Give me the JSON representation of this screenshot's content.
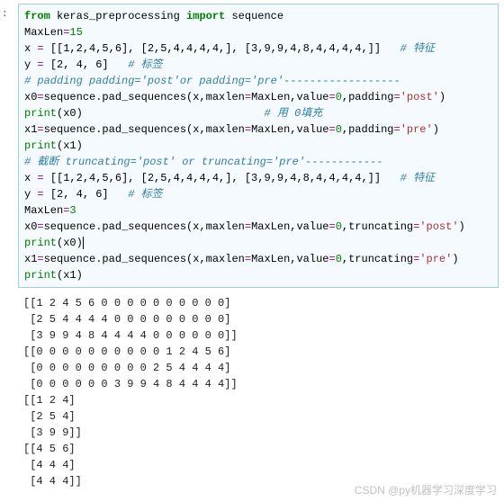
{
  "code": {
    "l1_from": "from",
    "l1_mod": " keras_preprocessing ",
    "l1_import": "import",
    "l1_seq": " sequence",
    "l2_a": "MaxLen",
    "l2_eq": "=",
    "l2_v": "15",
    "l3_a": "x ",
    "l3_eq": "= ",
    "l3_v": "[[1,2,4,5,6], [2,5,4,4,4,4,], [3,9,9,4,8,4,4,4,4,]]",
    "l3_c": "   # 特征",
    "l4_a": "y ",
    "l4_eq": "= ",
    "l4_v": "[2, 4, 6]",
    "l4_c": "   # 标签",
    "l5_c": "# padding padding='post'or padding='pre'------------------",
    "l6_a": "x0",
    "l6_eq": "=",
    "l6_b": "sequence.pad_sequences(x,maxlen",
    "l6_eq2": "=",
    "l6_c2": "MaxLen,value",
    "l6_eq3": "=",
    "l6_v0": "0",
    "l6_comma": ",padding",
    "l6_eq4": "=",
    "l6_str": "'post'",
    "l6_end": ")",
    "l7_a": "print",
    "l7_b": "(x0)",
    "l7_c": "                            # 用 0填充",
    "l8_a": "x1",
    "l8_eq": "=",
    "l8_b": "sequence.pad_sequences(x,maxlen",
    "l8_eq2": "=",
    "l8_c2": "MaxLen,value",
    "l8_eq3": "=",
    "l8_v0": "0",
    "l8_comma": ",padding",
    "l8_eq4": "=",
    "l8_str": "'pre'",
    "l8_end": ")",
    "l9_a": "print",
    "l9_b": "(x1)",
    "l10_c": "# 截断 truncating='post' or truncating='pre'------------",
    "l11_a": "x ",
    "l11_eq": "= ",
    "l11_v": "[[1,2,4,5,6], [2,5,4,4,4,4,], [3,9,9,4,8,4,4,4,4,]]",
    "l11_c": "   # 特征",
    "l12_a": "y ",
    "l12_eq": "= ",
    "l12_v": "[2, 4, 6]",
    "l12_c": "   # 标签",
    "l13_a": "MaxLen",
    "l13_eq": "=",
    "l13_v": "3",
    "l14_a": "x0",
    "l14_eq": "=",
    "l14_b": "sequence.pad_sequences(x,maxlen",
    "l14_eq2": "=",
    "l14_c2": "MaxLen,value",
    "l14_eq3": "=",
    "l14_v0": "0",
    "l14_comma": ",truncating",
    "l14_eq4": "=",
    "l14_str": "'post'",
    "l14_end": ")",
    "l15_a": "print",
    "l15_b": "(x0)",
    "l16_a": "x1",
    "l16_eq": "=",
    "l16_b": "sequence.pad_sequences(x,maxlen",
    "l16_eq2": "=",
    "l16_c2": "MaxLen,value",
    "l16_eq3": "=",
    "l16_v0": "0",
    "l16_comma": ",truncating",
    "l16_eq4": "=",
    "l16_str": "'pre'",
    "l16_end": ")",
    "l17_a": "print",
    "l17_b": "(x1)"
  },
  "output": {
    "r1": "[[1 2 4 5 6 0 0 0 0 0 0 0 0 0 0]",
    "r2": " [2 5 4 4 4 4 0 0 0 0 0 0 0 0 0]",
    "r3": " [3 9 9 4 8 4 4 4 4 0 0 0 0 0 0]]",
    "r4": "[[0 0 0 0 0 0 0 0 0 0 1 2 4 5 6]",
    "r5": " [0 0 0 0 0 0 0 0 0 2 5 4 4 4 4]",
    "r6": " [0 0 0 0 0 0 3 9 9 4 8 4 4 4 4]]",
    "r7": "[[1 2 4]",
    "r8": " [2 5 4]",
    "r9": " [3 9 9]]",
    "r10": "[[4 5 6]",
    "r11": " [4 4 4]",
    "r12": " [4 4 4]]"
  },
  "watermark": "CSDN @py机器学习深度学习",
  "prompt": ":"
}
